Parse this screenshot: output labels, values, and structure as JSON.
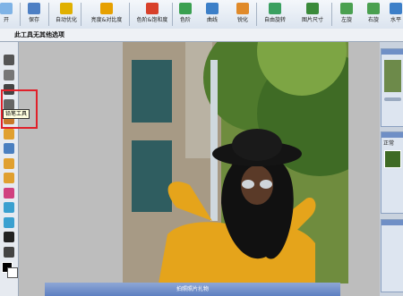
{
  "toolbar": {
    "items": [
      {
        "label": "开",
        "icon": "open-icon",
        "color": "#7fb3e6"
      },
      {
        "label": "保存",
        "icon": "save-icon",
        "color": "#4d7fc4"
      },
      {
        "label": "自动优化",
        "icon": "wand-icon",
        "color": "#e0b000"
      },
      {
        "label": "亮度&对比度",
        "icon": "brightness-icon",
        "color": "#e6a000"
      },
      {
        "label": "色阶&饱和度",
        "icon": "levels-icon",
        "color": "#d8402a"
      },
      {
        "label": "色阶",
        "icon": "curves-icon",
        "color": "#3aa050"
      },
      {
        "label": "曲线",
        "icon": "graph-icon",
        "color": "#3c7fc8"
      },
      {
        "label": "锐化",
        "icon": "sharpen-icon",
        "color": "#e08a2a"
      },
      {
        "label": "自由旋转",
        "icon": "rotate-icon",
        "color": "#3aa060"
      },
      {
        "label": "图片尺寸",
        "icon": "resize-icon",
        "color": "#3a8a3a"
      },
      {
        "label": "左旋",
        "icon": "rotate-left-icon",
        "color": "#4aa050"
      },
      {
        "label": "右旋",
        "icon": "rotate-right-icon",
        "color": "#4aa050"
      },
      {
        "label": "水平",
        "icon": "flip-icon",
        "color": "#3c7fc8"
      }
    ]
  },
  "options_bar": {
    "text": "此工具无其他选项"
  },
  "tools": [
    {
      "name": "move-tool-icon",
      "color": "#555"
    },
    {
      "name": "lasso-tool-icon",
      "color": "#777"
    },
    {
      "name": "text-tool-icon",
      "color": "#444"
    },
    {
      "name": "pen-tool-icon",
      "color": "#666"
    },
    {
      "name": "stamp-tool-icon",
      "color": "#c8782a"
    },
    {
      "name": "bucket-tool-icon",
      "color": "#e0a030"
    },
    {
      "name": "dropper-tool-icon",
      "color": "#4a7fc0"
    },
    {
      "name": "eraser-tool-icon",
      "color": "#e0a030"
    },
    {
      "name": "smudge-tool-icon",
      "color": "#e0a030"
    },
    {
      "name": "lens-tool-icon",
      "color": "#d04080"
    },
    {
      "name": "blur-tool-icon",
      "color": "#3aa0d0"
    },
    {
      "name": "sharpen-tool-icon",
      "color": "#3aa0d0"
    },
    {
      "name": "type-tool-icon",
      "color": "#222"
    },
    {
      "name": "zoom-tool-icon",
      "color": "#444"
    }
  ],
  "tooltip": {
    "text": "铅笔工具"
  },
  "bottom_strip": {
    "text": "拍照照片扎物"
  },
  "right_panel": {
    "label": "正常"
  }
}
